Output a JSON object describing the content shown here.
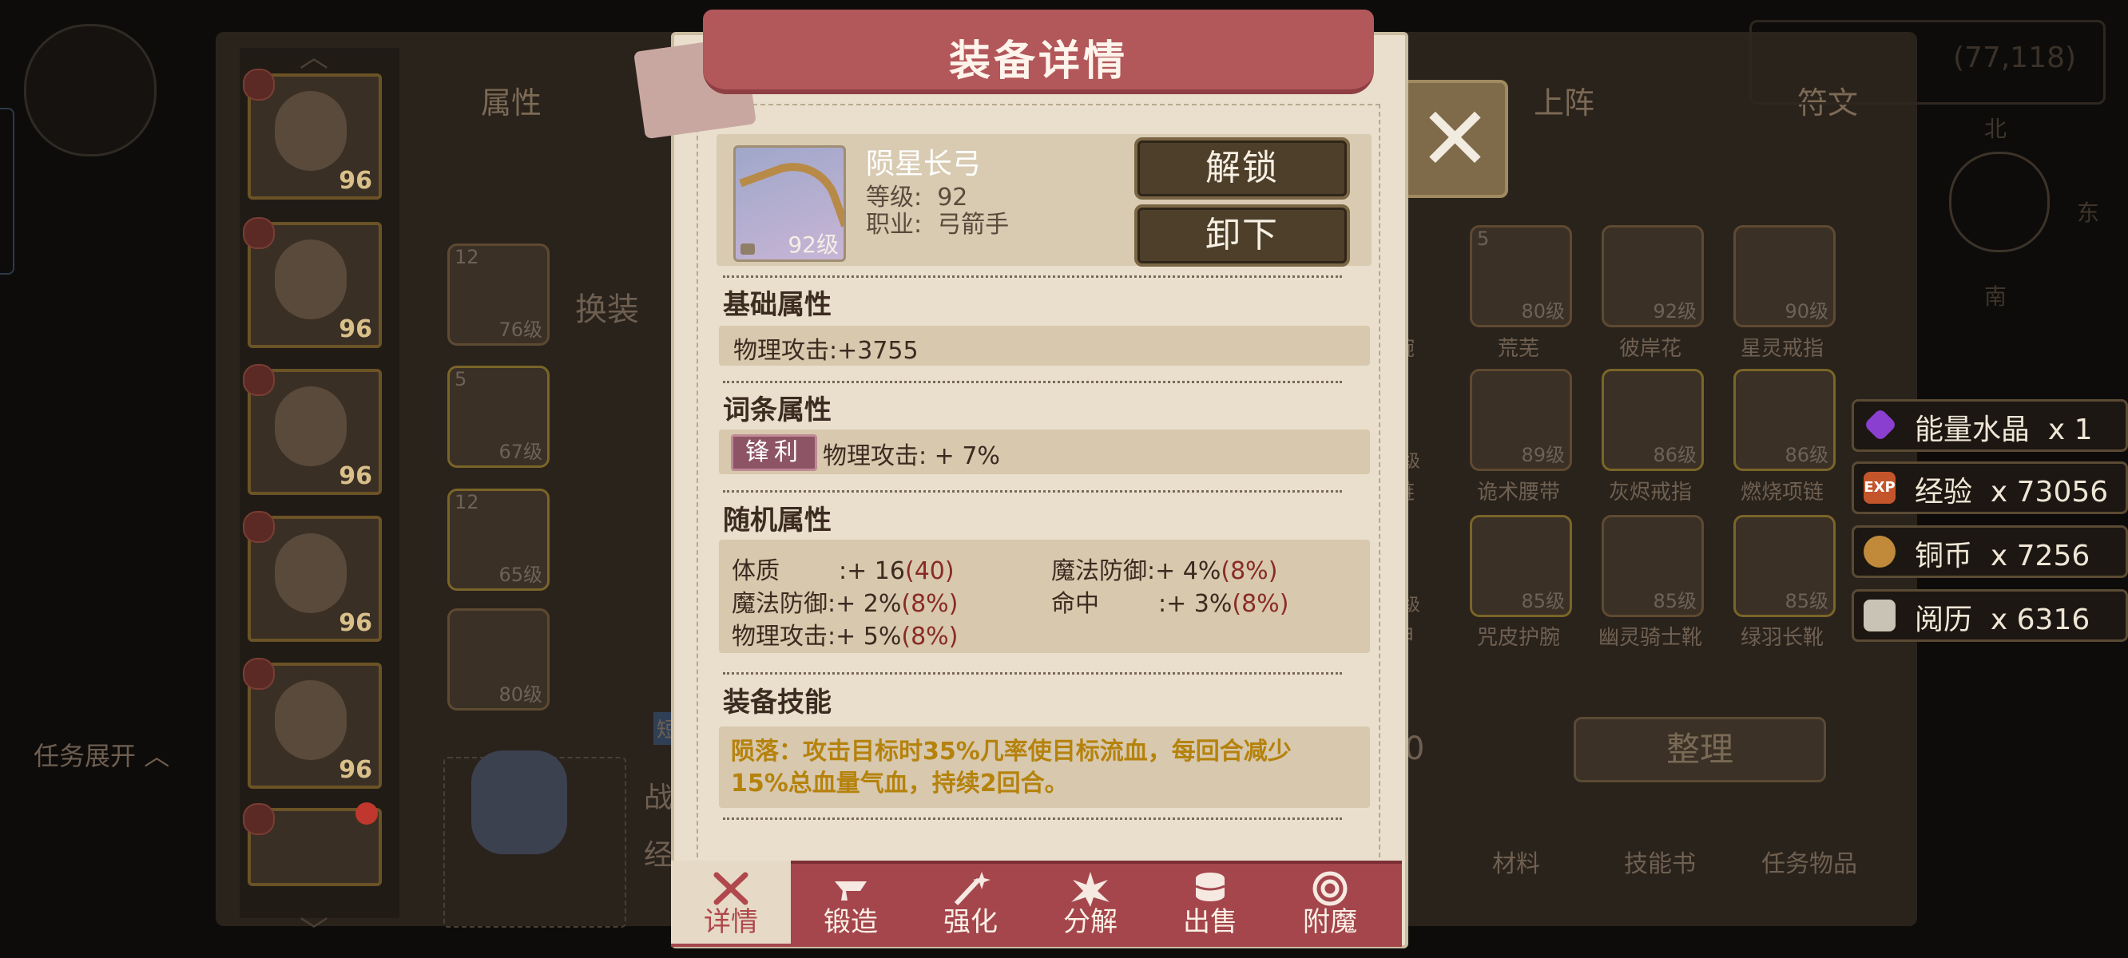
{
  "dialog": {
    "title": "装备详情",
    "item": {
      "name": "陨星长弓",
      "level_label": "等级:",
      "level_value": "92",
      "class_label": "职业:",
      "class_value": "弓箭手",
      "icon_level": "92级"
    },
    "buttons": {
      "unlock": "解锁",
      "unequip": "卸下"
    },
    "sections": {
      "base": {
        "title": "基础属性",
        "stat": "物理攻击:+3755"
      },
      "affix": {
        "title": "词条属性",
        "tag": "锋利",
        "stat": "物理攻击: + 7%"
      },
      "random": {
        "title": "随机属性",
        "stats": [
          {
            "label": "体质",
            "sep": ":+",
            "value": "16",
            "max": "(40)"
          },
          {
            "label": "魔法防御",
            "sep": ":+",
            "value": "4%",
            "max": "(8%)"
          },
          {
            "label": "魔法防御",
            "sep": ":+",
            "value": "2%",
            "max": "(8%)"
          },
          {
            "label": "命中",
            "sep": ":+",
            "value": "3%",
            "max": "(8%)"
          },
          {
            "label": "物理攻击",
            "sep": ":+",
            "value": "5%",
            "max": "(8%)"
          }
        ]
      },
      "skill": {
        "title": "装备技能",
        "text": "陨落：攻击目标时35%几率使目标流血，每回合减少15%总血量气血，持续2回合。"
      }
    },
    "tabs": [
      {
        "label": "详情",
        "icon": "hammer-cross-icon",
        "active": true
      },
      {
        "label": "锻造",
        "icon": "anvil-icon",
        "active": false
      },
      {
        "label": "强化",
        "icon": "sparkle-wand-icon",
        "active": false
      },
      {
        "label": "分解",
        "icon": "shatter-icon",
        "active": false
      },
      {
        "label": "出售",
        "icon": "coins-icon",
        "active": false
      },
      {
        "label": "附魔",
        "icon": "swirl-icon",
        "active": false
      }
    ]
  },
  "background": {
    "tabs": [
      "属性",
      "上阵",
      "符文"
    ],
    "hero_levels": [
      "96",
      "96",
      "96",
      "96",
      "96"
    ],
    "change_outfit": "换装",
    "task_expand": "任务展开",
    "sort_button": "整理",
    "power_value": "(77,118)",
    "compass": {
      "north": "北",
      "east": "东",
      "south": "南"
    },
    "left_items": [
      {
        "count": "12",
        "level": "76级"
      },
      {
        "count": "5",
        "level": "67级"
      },
      {
        "count": "12",
        "level": "65级"
      },
      {
        "count": "",
        "level": "80级"
      }
    ],
    "grid_items": [
      {
        "name": "荒芜",
        "level": "80级",
        "count": "5"
      },
      {
        "name": "彼岸花",
        "level": "92级",
        "count": ""
      },
      {
        "name": "星灵戒指",
        "level": "90级",
        "count": ""
      },
      {
        "name": "诡术腰带",
        "level": "89级",
        "count": ""
      },
      {
        "name": "灰烬戒指",
        "level": "86级",
        "count": ""
      },
      {
        "name": "燃烧项链",
        "level": "86级",
        "count": ""
      },
      {
        "name": "咒皮护腕",
        "level": "85级",
        "count": ""
      },
      {
        "name": "幽灵骑士靴",
        "level": "85级",
        "count": ""
      },
      {
        "name": "绿羽长靴",
        "level": "85级",
        "count": ""
      }
    ],
    "partial_labels": [
      "腕",
      "链",
      "甲"
    ],
    "partial_levels": [
      "0级",
      "5级"
    ],
    "bottom_tabs": [
      "材料",
      "技能书",
      "任务物品"
    ],
    "left_stub_labels": [
      "战",
      "经"
    ],
    "left_small": "短",
    "zero": "0"
  },
  "rewards": [
    {
      "label": "能量水晶",
      "amount": "x 1",
      "icon": "crystal-icon",
      "color": "#8b3fd0"
    },
    {
      "label": "经验",
      "amount": "x 73056",
      "icon": "exp-icon",
      "color": "#c4552b"
    },
    {
      "label": "铜币",
      "amount": "x 7256",
      "icon": "coin-icon",
      "color": "#c08a3a"
    },
    {
      "label": "阅历",
      "amount": "x 6316",
      "icon": "book-icon",
      "color": "#c9c3b5"
    }
  ]
}
